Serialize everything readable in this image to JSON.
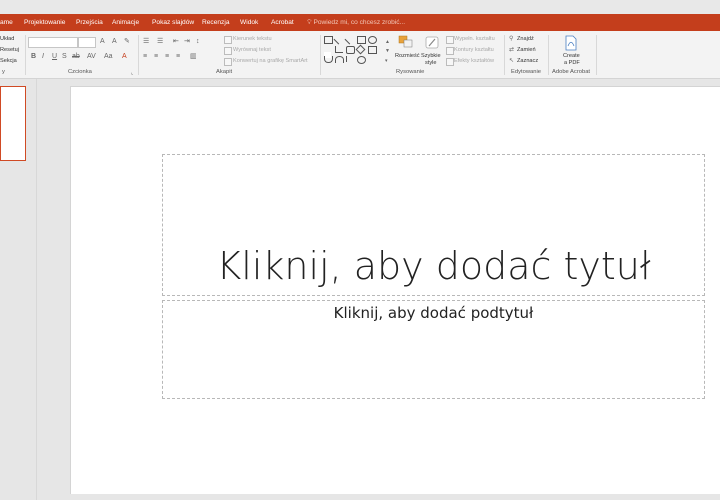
{
  "tabs": [
    {
      "label": "ame"
    },
    {
      "label": "Projektowanie"
    },
    {
      "label": "Przejścia"
    },
    {
      "label": "Animacje"
    },
    {
      "label": "Pokaz slajdów"
    },
    {
      "label": "Recenzja"
    },
    {
      "label": "Widok"
    },
    {
      "label": "Acrobat"
    }
  ],
  "tell_me": "Powiedz mi, co chcesz zrobić...",
  "ribbon": {
    "slides": {
      "layout": "Układ",
      "reset": "Resetuj",
      "section": "Sekcja",
      "label": "y"
    },
    "font": {
      "label": "Czcionka"
    },
    "paragraph": {
      "text_direction": "Kierunek tekstu",
      "align_text": "Wyrównaj tekst",
      "smartart": "Konwertuj na grafikę SmartArt",
      "label": "Akapit"
    },
    "drawing": {
      "arrange": "Rozmieść",
      "quick_styles_1": "Szybkie",
      "quick_styles_2": "style",
      "fill": "Wypełn. kształtu",
      "outline": "Kontury kształtu",
      "effects": "Efekty kształtów",
      "label": "Rysowanie"
    },
    "editing": {
      "find": "Znajdź",
      "replace": "Zamień",
      "select": "Zaznacz",
      "label": "Edytowanie"
    },
    "acrobat": {
      "create_1": "Create",
      "create_2": "a PDF",
      "label": "Adobe Acrobat"
    }
  },
  "slide": {
    "title_placeholder": "Kliknij, aby dodać tytuł",
    "subtitle_placeholder": "Kliknij, aby dodać podtytuł"
  },
  "colors": {
    "accent": "#c43e1c",
    "ribbon_bg": "#f3f3f3",
    "workspace": "#e6e6e6"
  }
}
